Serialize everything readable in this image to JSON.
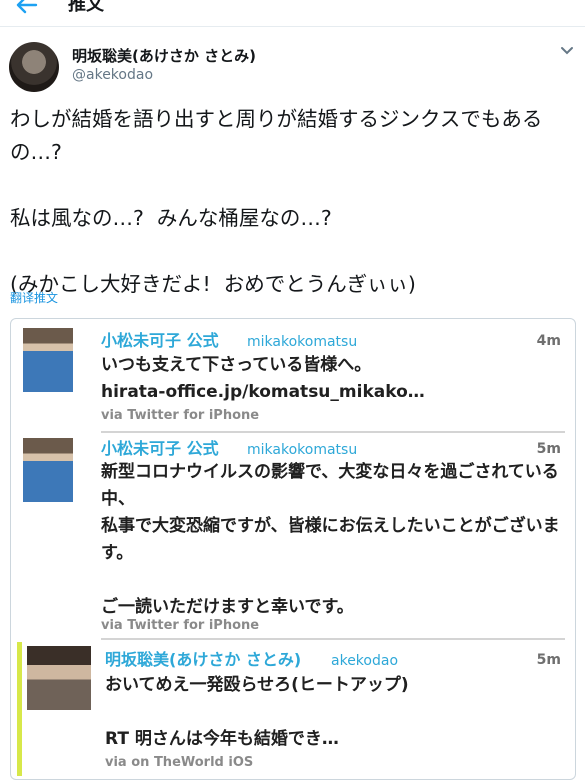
{
  "header": {
    "title": "推文"
  },
  "tweet": {
    "display_name": "明坂聡美(あけさか さとみ)",
    "handle": "@akekodao",
    "text": "わしが結婚を語り出すと周りが結婚するジンクスでもあるの…?\n\n私は風なの…?  みんな桶屋なの…?\n\n(みかこし大好きだよ!  おめでとうんぎぃぃ)",
    "translate_label": "翻译推文"
  },
  "quoted": [
    {
      "name": "小松未可子 公式",
      "handle": "mikakokomatsu",
      "time": "4m",
      "text": "いつも支えて下さっている皆様へ。\nhirata-office.jp/komatsu_mikako…",
      "via": "via Twitter for iPhone"
    },
    {
      "name": "小松未可子 公式",
      "handle": "mikakokomatsu",
      "time": "5m",
      "text": "新型コロナウイルスの影響で、大変な日々を過ごされている中、\n私事で大変恐縮ですが、皆様にお伝えしたいことがございます。\n\nご一読いただけますと幸いです。",
      "via": "via Twitter for iPhone"
    },
    {
      "name": "明坂聡美(あけさか さとみ)",
      "handle": "akekodao",
      "time": "5m",
      "text": "おいてめえ一発殴らせろ(ヒートアップ)\n\nRT 明さんは今年も結婚でき…",
      "via": "via on TheWorld iOS"
    }
  ],
  "colors": {
    "link": "#1b95e0",
    "quote_name": "#2ea8d8",
    "accent_bar": "#d7e84a"
  },
  "icons": {
    "back": "arrow-left-icon",
    "more": "chevron-down-icon"
  }
}
